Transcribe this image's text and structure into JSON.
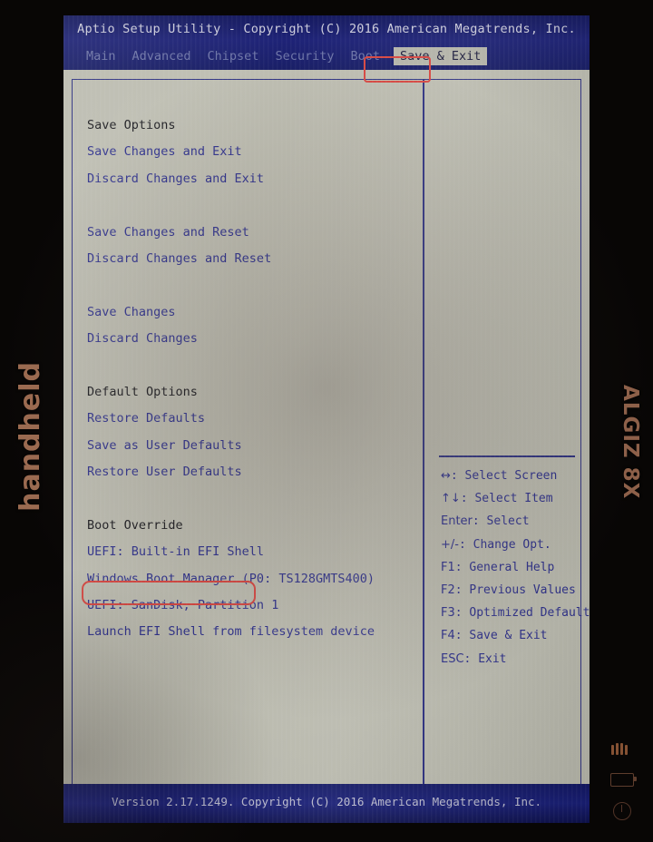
{
  "device": {
    "brand_left": "handheld",
    "brand_right": "ALGIZ 8X",
    "icons": {
      "signal": "signal-icon",
      "battery": "battery-icon",
      "power": "power-icon"
    }
  },
  "bios": {
    "title": "Aptio Setup Utility - Copyright (C) 2016 American Megatrends, Inc.",
    "version_bar": "Version 2.17.1249. Copyright (C) 2016 American Megatrends, Inc.",
    "tabs": [
      {
        "label": "Main",
        "selected": false
      },
      {
        "label": "Advanced",
        "selected": false
      },
      {
        "label": "Chipset",
        "selected": false
      },
      {
        "label": "Security",
        "selected": false
      },
      {
        "label": "Boot",
        "selected": false
      },
      {
        "label": "Save & Exit",
        "selected": true
      }
    ],
    "options": [
      {
        "label": "Save Options",
        "type": "header"
      },
      {
        "label": "Save Changes and Exit",
        "type": "item"
      },
      {
        "label": "Discard Changes and Exit",
        "type": "item"
      },
      {
        "label": "",
        "type": "spacer"
      },
      {
        "label": "Save Changes and Reset",
        "type": "item"
      },
      {
        "label": "Discard Changes and Reset",
        "type": "item"
      },
      {
        "label": "",
        "type": "spacer"
      },
      {
        "label": "Save Changes",
        "type": "item"
      },
      {
        "label": "Discard Changes",
        "type": "item"
      },
      {
        "label": "",
        "type": "spacer"
      },
      {
        "label": "Default Options",
        "type": "header"
      },
      {
        "label": "Restore Defaults",
        "type": "item"
      },
      {
        "label": "Save as User Defaults",
        "type": "item"
      },
      {
        "label": "Restore User Defaults",
        "type": "item"
      },
      {
        "label": "",
        "type": "spacer"
      },
      {
        "label": "Boot Override",
        "type": "header"
      },
      {
        "label": "UEFI: Built-in EFI Shell",
        "type": "item"
      },
      {
        "label": "Windows Boot Manager (P0: TS128GMTS400)",
        "type": "item"
      },
      {
        "label": "UEFI: SanDisk, Partition 1",
        "type": "item",
        "annotated": true
      },
      {
        "label": "Launch EFI Shell from filesystem device",
        "type": "item"
      }
    ],
    "help": [
      {
        "keys": "↔",
        "text": ": Select Screen"
      },
      {
        "keys": "↑↓",
        "text": ": Select Item"
      },
      {
        "keys": "Enter",
        "text": ": Select"
      },
      {
        "keys": "+/-",
        "text": ": Change Opt."
      },
      {
        "keys": "F1",
        "text": ": General Help"
      },
      {
        "keys": "F2",
        "text": ": Previous Values"
      },
      {
        "keys": "F3",
        "text": ": Optimized Defaults"
      },
      {
        "keys": "F4",
        "text": ": Save & Exit"
      },
      {
        "keys": "ESC",
        "text": ": Exit"
      }
    ]
  },
  "colors": {
    "screen_bg": "#c7c7ba",
    "bar_blue": "#151a6e",
    "text_blue": "#2c2f92",
    "header_text": "#17171c",
    "selected_tab_bg": "#bdbdb1",
    "annotation_red": "#e2453f",
    "bezel_brand": "#8a5c44"
  }
}
